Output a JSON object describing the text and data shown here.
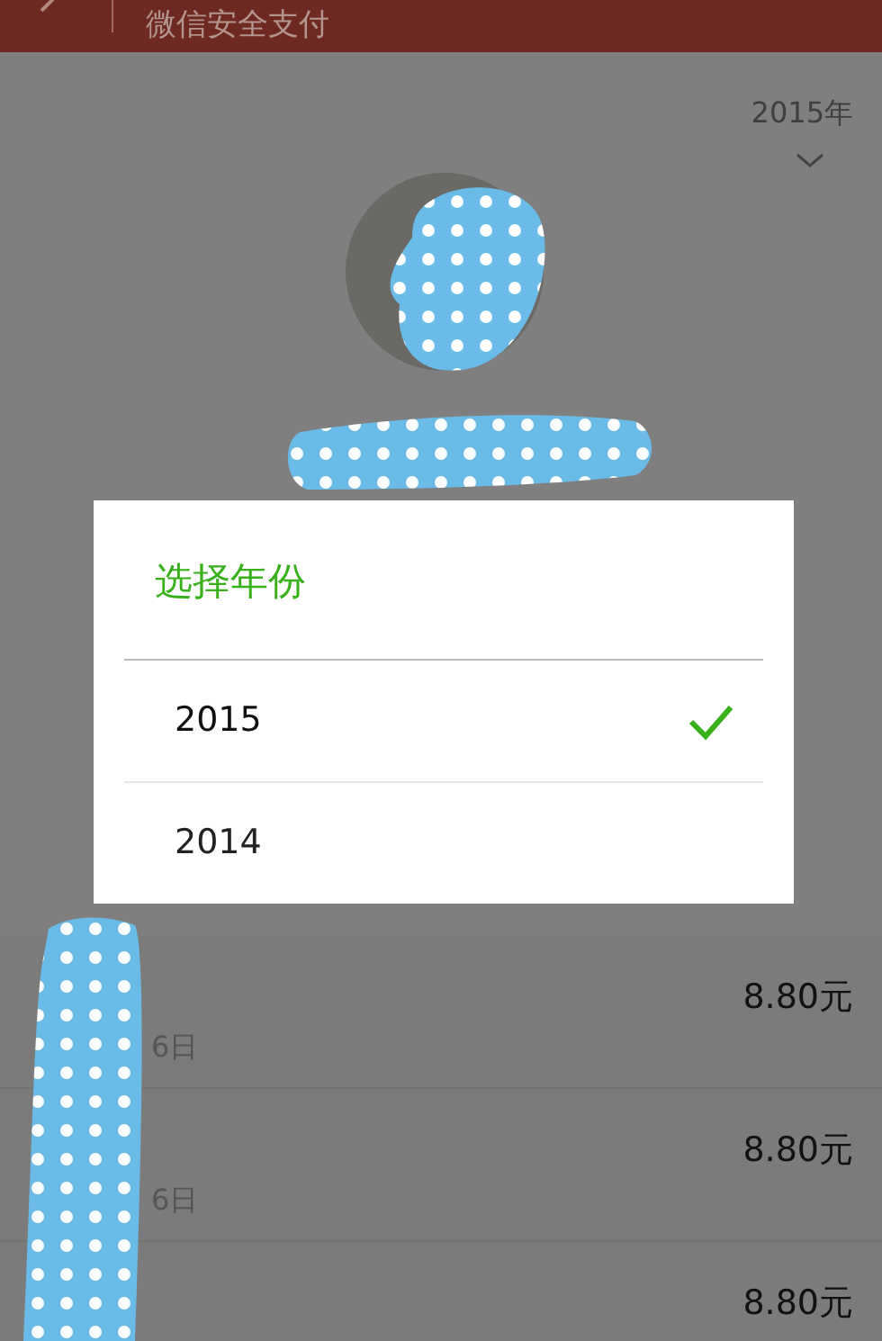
{
  "header": {
    "title": "微信安全支付"
  },
  "year_selector": {
    "label": "2015年"
  },
  "dialog": {
    "title": "选择年份",
    "options": [
      {
        "label": "2015",
        "selected": true
      },
      {
        "label": "2014",
        "selected": false
      }
    ]
  },
  "records": [
    {
      "amount": "8.80元",
      "date": "6日"
    },
    {
      "amount": "8.80元",
      "date": "6日"
    },
    {
      "amount": "8.80元"
    }
  ]
}
